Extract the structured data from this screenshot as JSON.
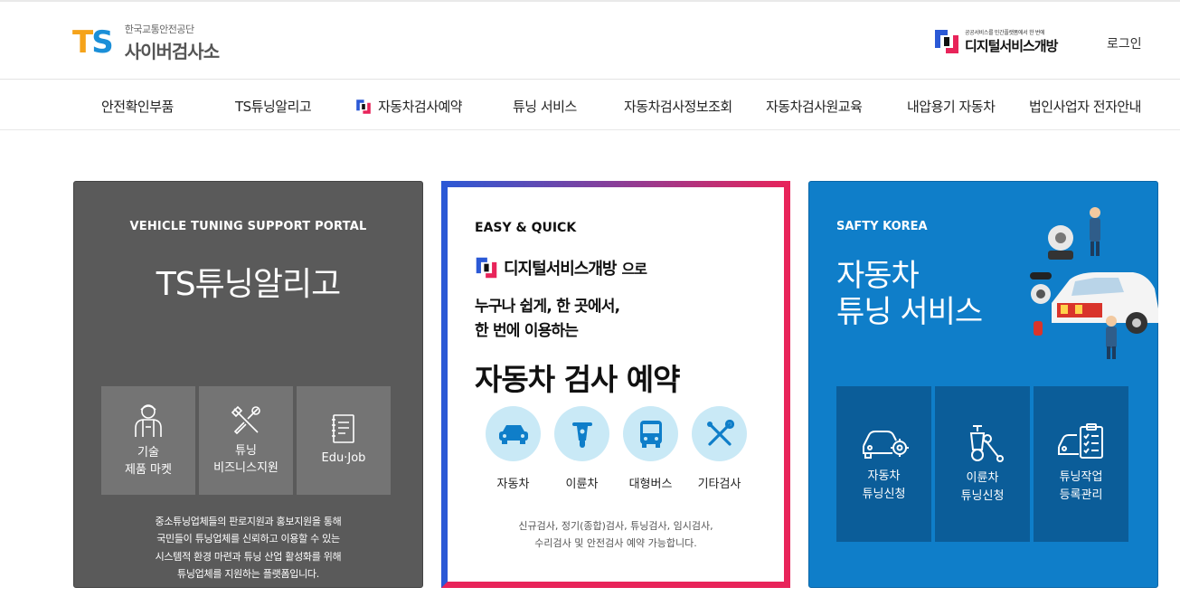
{
  "header": {
    "logo_ts": "TS",
    "logo_sub": "한국교통안전공단",
    "logo_main": "사이버검사소",
    "dsb_sub": "공공서비스를 민간플랫폼에서 한 번에",
    "dsb_main": "디지털서비스개방",
    "login": "로그인"
  },
  "nav": {
    "items": [
      "안전확인부품",
      "TS튜닝알리고",
      "자동차검사예약",
      "튜닝 서비스",
      "자동차검사정보조회",
      "자동차검사원교육",
      "내압용기 자동차",
      "법인사업자 전자안내"
    ]
  },
  "left": {
    "eyebrow": "VEHICLE TUNING SUPPORT PORTAL",
    "title": "TS튜닝알리고",
    "tiles": [
      {
        "line1": "기술",
        "line2": "제품 마켓"
      },
      {
        "line1": "튜닝",
        "line2": "비즈니스지원"
      },
      {
        "line1": "Edu·Job",
        "line2": ""
      }
    ],
    "desc": [
      "중소튜닝업체들의 판로지원과 홍보지원을 통해",
      "국민들이 튜닝업체를 신뢰하고 이용할 수 있는",
      "시스템적 환경 마련과 튜닝 산업 활성화를 위해",
      "튜닝업체를 지원하는 플랫폼입니다."
    ]
  },
  "mid": {
    "eyebrow": "EASY & QUICK",
    "brand": "디지털서비스개방",
    "brand_suffix": "으로",
    "line1": "누구나 쉽게, 한 곳에서,",
    "line2": "한 번에 이용하는",
    "big": "자동차 검사 예약",
    "icons": [
      {
        "label": "자동차",
        "icon": "car-icon"
      },
      {
        "label": "이륜차",
        "icon": "motorcycle-icon"
      },
      {
        "label": "대형버스",
        "icon": "bus-icon"
      },
      {
        "label": "기타검사",
        "icon": "tools-icon"
      }
    ],
    "desc": [
      "신규검사, 정기(종합)검사, 튜닝검사, 임시검사,",
      "수리검사 및 안전검사 예약 가능합니다."
    ]
  },
  "right": {
    "eyebrow": "SAFTY KOREA",
    "title_line1": "자동차",
    "title_line2": "튜닝 서비스",
    "tiles": [
      {
        "line1": "자동차",
        "line2": "튜닝신청"
      },
      {
        "line1": "이륜차",
        "line2": "튜닝신청"
      },
      {
        "line1": "튜닝작업",
        "line2": "등록관리"
      }
    ]
  },
  "colors": {
    "accent_red": "#e8245a",
    "accent_blue": "#2b59d6",
    "left_bg": "#5a5a5a",
    "right_bg": "#0f7ec9"
  }
}
